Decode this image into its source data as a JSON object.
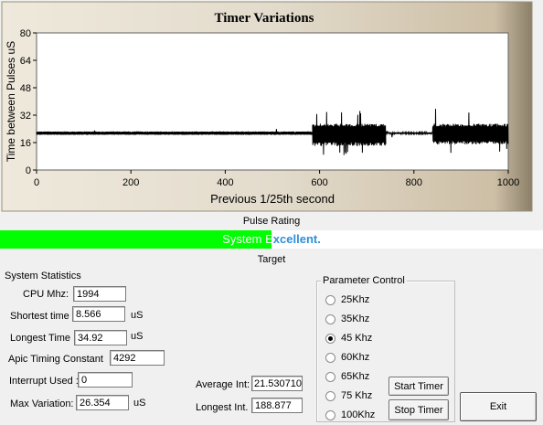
{
  "chart_data": {
    "type": "line",
    "title": "Timer Variations",
    "xlabel": "Previous 1/25th second",
    "ylabel": "Time between Pulses uS",
    "xlim": [
      0,
      1000
    ],
    "ylim": [
      0,
      80
    ],
    "x_ticks": [
      0,
      200,
      400,
      600,
      800,
      1000
    ],
    "y_ticks": [
      0,
      16,
      32,
      48,
      64,
      80
    ],
    "baseline": 21.5,
    "segments": [
      {
        "from": 0,
        "to": 585,
        "center": 21.5,
        "low": 20.5,
        "high": 22.5,
        "spike_high": 24
      },
      {
        "from": 585,
        "to": 740,
        "center": 21.5,
        "low": 14,
        "high": 27,
        "spike_high": 35,
        "spike_low": 8
      },
      {
        "from": 740,
        "to": 840,
        "center": 21.5,
        "low": 21,
        "high": 22,
        "spike_high": 22,
        "spike_low": 21
      },
      {
        "from": 840,
        "to": 1000,
        "center": 21.5,
        "low": 15,
        "high": 27,
        "spike_high": 36,
        "spike_low": 10
      }
    ],
    "line_color": "#000000",
    "panel_colors": {
      "frame": "#d8cfbe",
      "plot_bg": "#ffffff"
    }
  },
  "rating": {
    "caption": "Pulse Rating",
    "status_left": "System E",
    "status_right": "xcellent.",
    "progress": 0.5,
    "bar_color": "#00ff00",
    "text_color_on_bar": "#ffffff",
    "text_color_off_bar": "#2f8fd8",
    "target_caption": "Target"
  },
  "stats": {
    "group_title": "System Statistics",
    "cpu_label": "CPU Mhz:",
    "cpu_value": "1994",
    "shortest_label": "Shortest time",
    "shortest_value": "8.566",
    "shortest_unit": "uS",
    "longest_label": "Longest Time",
    "longest_value": "34.92",
    "longest_unit": "uS",
    "apic_label": "Apic Timing Constant",
    "apic_value": "4292",
    "interrupt_label": "Interrupt Used :",
    "interrupt_value": "0",
    "maxvar_label": "Max Variation:",
    "maxvar_value": "26.354",
    "maxvar_unit": "uS",
    "avg_label": "Average Int:",
    "avg_value": "21.530710",
    "longint_label": "Longest Int.",
    "longint_value": "188.877"
  },
  "param": {
    "group_title": "Parameter Control",
    "options": [
      "25Khz",
      "35Khz",
      "45 Khz",
      "60Khz",
      "65Khz",
      "75 Khz",
      "100Khz"
    ],
    "selected_index": 2,
    "start_label": "Start Timer",
    "stop_label": "Stop Timer"
  },
  "exit_label": "Exit"
}
